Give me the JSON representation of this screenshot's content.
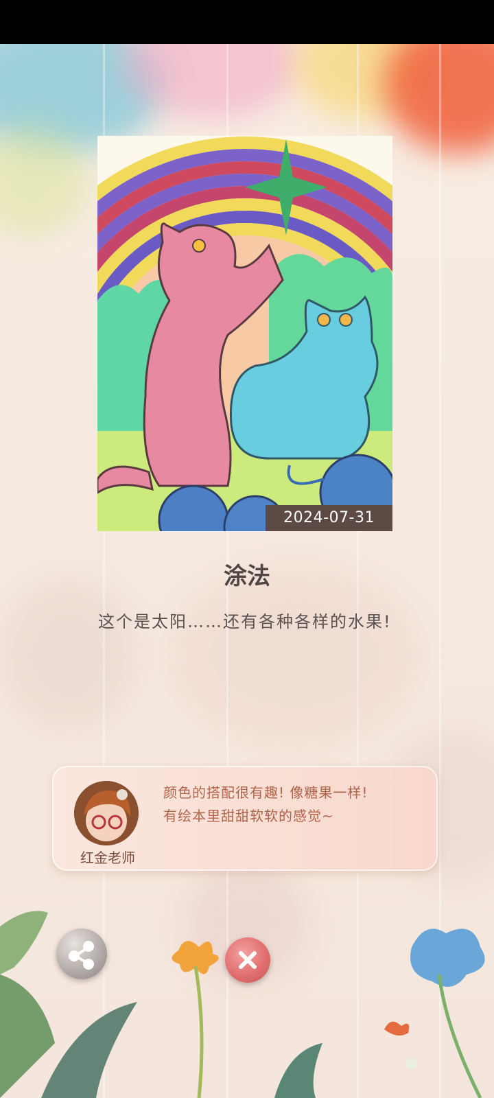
{
  "artwork": {
    "date": "2024-07-31"
  },
  "title": "涂法",
  "description": "这个是太阳……还有各种各样的水果!",
  "comment": {
    "teacher_name": "红金老师",
    "lines": [
      "颜色的搭配很有趣! 像糖果一样!",
      "有绘本里甜甜软软的感觉~"
    ]
  },
  "icons": {
    "share": "share-icon",
    "close": "close-icon"
  },
  "colors": {
    "date_tag_bg": "#5d4a45",
    "comment_text": "#b3624a",
    "close_button": "#df6c6c"
  }
}
